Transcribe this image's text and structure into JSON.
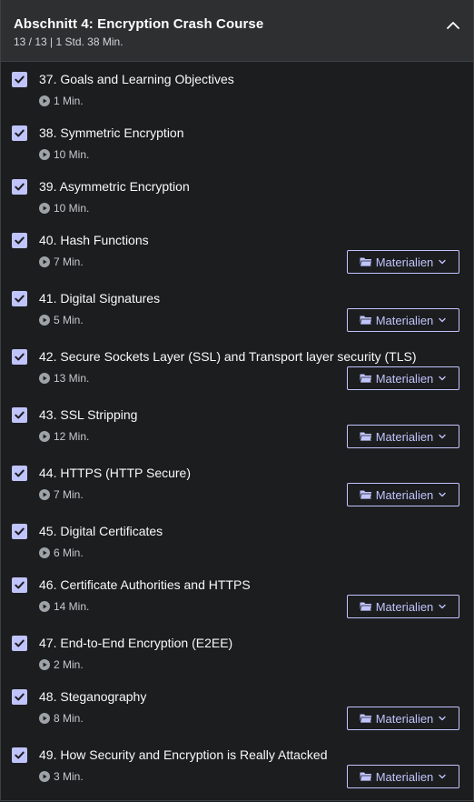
{
  "section": {
    "title": "Abschnitt 4: Encryption Crash Course",
    "meta": "13 / 13 | 1 Std. 38 Min."
  },
  "colors": {
    "accent": "#c0c4fc",
    "background": "#1c1d1f",
    "header": "#2d2f31"
  },
  "materials_label": "Materialien",
  "lessons": [
    {
      "title": "37. Goals and Learning Objectives",
      "duration": "1 Min.",
      "completed": true,
      "has_materials": false
    },
    {
      "title": "38. Symmetric Encryption",
      "duration": "10 Min.",
      "completed": true,
      "has_materials": false
    },
    {
      "title": "39. Asymmetric Encryption",
      "duration": "10 Min.",
      "completed": true,
      "has_materials": false
    },
    {
      "title": "40. Hash Functions",
      "duration": "7 Min.",
      "completed": true,
      "has_materials": true
    },
    {
      "title": "41. Digital Signatures",
      "duration": "5 Min.",
      "completed": true,
      "has_materials": true
    },
    {
      "title": "42. Secure Sockets Layer (SSL) and Transport layer security (TLS)",
      "duration": "13 Min.",
      "completed": true,
      "has_materials": true
    },
    {
      "title": "43. SSL Stripping",
      "duration": "12 Min.",
      "completed": true,
      "has_materials": true
    },
    {
      "title": "44. HTTPS (HTTP Secure)",
      "duration": "7 Min.",
      "completed": true,
      "has_materials": true
    },
    {
      "title": "45. Digital Certificates",
      "duration": "6 Min.",
      "completed": true,
      "has_materials": false
    },
    {
      "title": "46. Certificate Authorities and HTTPS",
      "duration": "14 Min.",
      "completed": true,
      "has_materials": true
    },
    {
      "title": "47. End-to-End Encryption (E2EE)",
      "duration": "2 Min.",
      "completed": true,
      "has_materials": false
    },
    {
      "title": "48. Steganography",
      "duration": "8 Min.",
      "completed": true,
      "has_materials": true
    },
    {
      "title": "49. How Security and Encryption is Really Attacked",
      "duration": "3 Min.",
      "completed": true,
      "has_materials": true
    }
  ]
}
